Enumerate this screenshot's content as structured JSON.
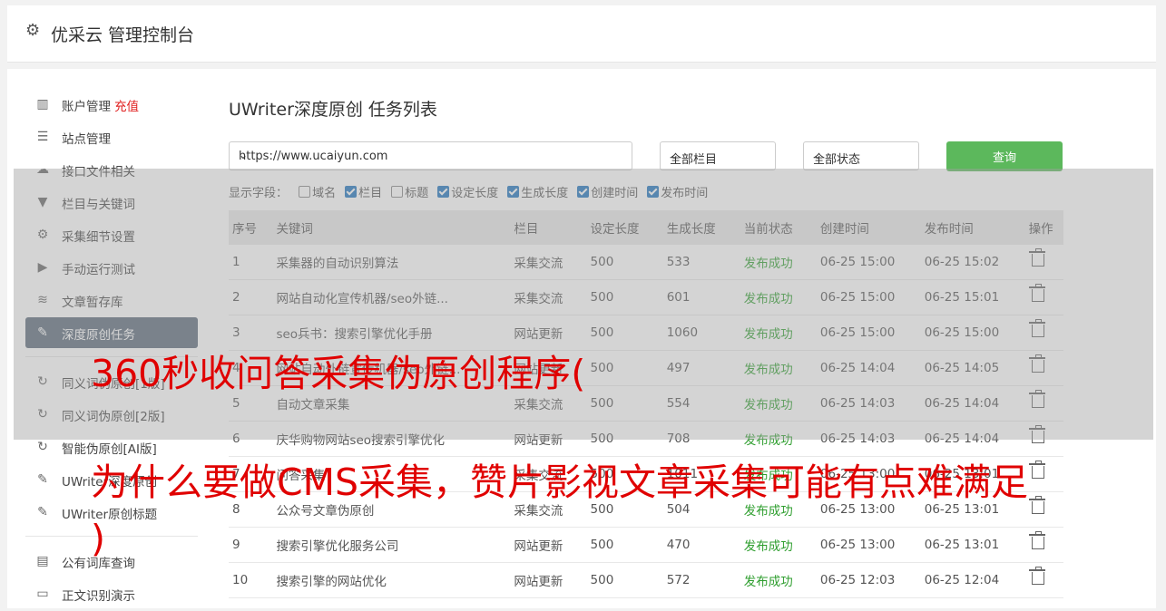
{
  "header": {
    "title": "优采云 管理控制台"
  },
  "sidebar": {
    "group1": [
      {
        "icon": "bar-chart-icon",
        "label": "账户管理",
        "tag": "充值"
      },
      {
        "icon": "server-icon",
        "label": "站点管理"
      },
      {
        "icon": "cloud-upload-icon",
        "label": "接口文件相关"
      },
      {
        "icon": "filter-icon",
        "label": "栏目与关键词"
      },
      {
        "icon": "cogs-icon",
        "label": "采集细节设置"
      },
      {
        "icon": "play-circle-icon",
        "label": "手动运行测试"
      },
      {
        "icon": "database-icon",
        "label": "文章暂存库"
      },
      {
        "icon": "edit-icon",
        "label": "深度原创任务",
        "active": true
      }
    ],
    "group2": [
      {
        "icon": "refresh-icon",
        "label": "同义词伪原创[1版]"
      },
      {
        "icon": "refresh-icon",
        "label": "同义词伪原创[2版]"
      },
      {
        "icon": "refresh-icon",
        "label": "智能伪原创[AI版]"
      },
      {
        "icon": "edit-icon",
        "label": "UWriter深度原创"
      },
      {
        "icon": "edit-icon",
        "label": "UWriter原创标题"
      }
    ],
    "group3": [
      {
        "icon": "book-icon",
        "label": "公有词库查询"
      },
      {
        "icon": "monitor-icon",
        "label": "正文识别演示"
      }
    ]
  },
  "content": {
    "title": "UWriter深度原创 任务列表",
    "site_select": "https://www.ucaiyun.com",
    "column_select": "全部栏目",
    "status_select": "全部状态",
    "query_button": "查询",
    "fields_label": "显示字段：",
    "fields": [
      {
        "label": "域名",
        "checked": false
      },
      {
        "label": "栏目",
        "checked": true
      },
      {
        "label": "标题",
        "checked": false
      },
      {
        "label": "设定长度",
        "checked": true
      },
      {
        "label": "生成长度",
        "checked": true
      },
      {
        "label": "创建时间",
        "checked": true
      },
      {
        "label": "发布时间",
        "checked": true
      }
    ],
    "table": {
      "headers": [
        "序号",
        "关键词",
        "栏目",
        "设定长度",
        "生成长度",
        "当前状态",
        "创建时间",
        "发布时间",
        "操作"
      ],
      "rows": [
        [
          "1",
          "采集器的自动识别算法",
          "采集交流",
          "500",
          "533",
          "发布成功",
          "06-25 15:00",
          "06-25 15:02"
        ],
        [
          "2",
          "网站自动化宣传机器/seo外链...",
          "采集交流",
          "500",
          "601",
          "发布成功",
          "06-25 15:00",
          "06-25 15:01"
        ],
        [
          "3",
          "seo兵书：搜索引擎优化手册",
          "网站更新",
          "500",
          "1060",
          "发布成功",
          "06-25 15:00",
          "06-25 15:00"
        ],
        [
          "4",
          "网站自动外链宣传机器/seo外链...",
          "网站更新",
          "500",
          "497",
          "发布成功",
          "06-25 14:04",
          "06-25 14:05"
        ],
        [
          "5",
          "自动文章采集",
          "采集交流",
          "500",
          "554",
          "发布成功",
          "06-25 14:03",
          "06-25 14:04"
        ],
        [
          "6",
          "庆华购物网站seo搜索引擎优化",
          "网站更新",
          "500",
          "708",
          "发布成功",
          "06-25 14:03",
          "06-25 14:04"
        ],
        [
          "7",
          "问答采集",
          "采集交流",
          "500",
          "1011",
          "发布成功",
          "06-25 13:00",
          "06-25 13:01"
        ],
        [
          "8",
          "公众号文章伪原创",
          "采集交流",
          "500",
          "504",
          "发布成功",
          "06-25 13:00",
          "06-25 13:01"
        ],
        [
          "9",
          "搜索引擎优化服务公司",
          "网站更新",
          "500",
          "470",
          "发布成功",
          "06-25 13:00",
          "06-25 13:01"
        ],
        [
          "10",
          "搜索引擎的网站优化",
          "网站更新",
          "500",
          "572",
          "发布成功",
          "06-25 12:03",
          "06-25 12:04"
        ]
      ]
    }
  },
  "overlay": {
    "line1": "360秒收问答采集伪原创程序(",
    "line2": "为什么要做CMS采集，赞片影视文章采集可能有点难满足",
    "line3": ")"
  }
}
